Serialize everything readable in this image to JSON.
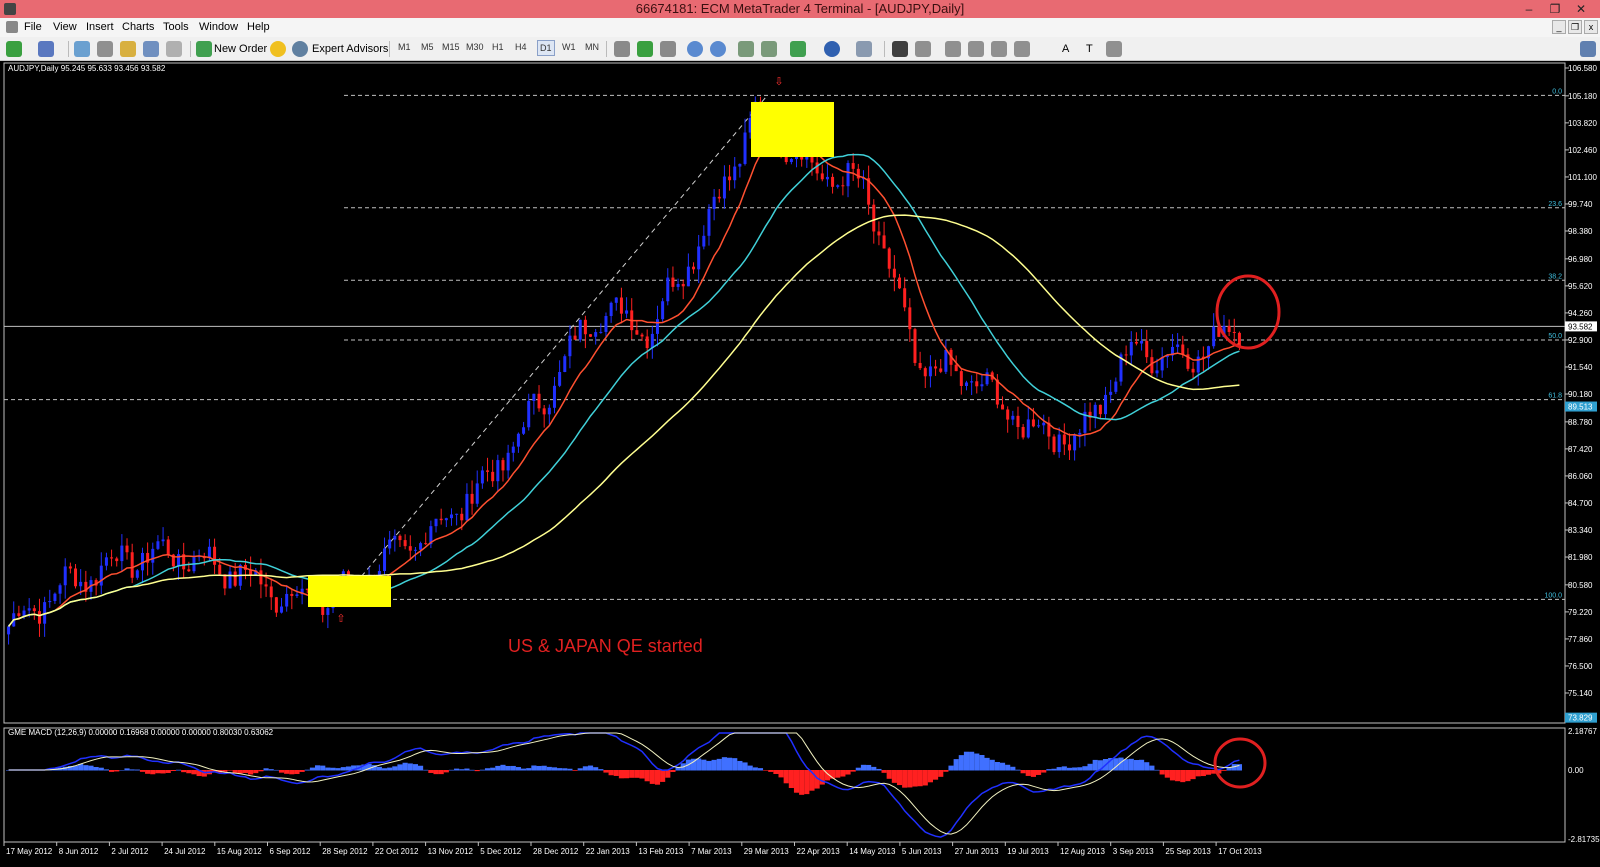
{
  "window": {
    "title": "66674181: ECM MetaTrader 4 Terminal - [AUDJPY,Daily]",
    "controls": [
      "–",
      "❐",
      "✕"
    ],
    "mdi_controls": [
      "_",
      "❐",
      "x"
    ]
  },
  "menu": [
    "File",
    "View",
    "Insert",
    "Charts",
    "Tools",
    "Window",
    "Help"
  ],
  "toolbar": {
    "new_order": "New Order",
    "expert_advisors": "Expert Advisors",
    "timeframes": [
      "M1",
      "M5",
      "M15",
      "M30",
      "H1",
      "H4",
      "D1",
      "W1",
      "MN"
    ],
    "text_tool": "A",
    "label_tool": "T"
  },
  "chart": {
    "info": "AUDJPY,Daily  95.245 95.633 93.456 93.582",
    "price_axis": [
      "106.580",
      "105.180",
      "103.820",
      "102.460",
      "101.100",
      "99.740",
      "98.380",
      "96.980",
      "95.620",
      "94.260",
      "92.900",
      "91.540",
      "90.180",
      "88.780",
      "87.420",
      "86.060",
      "84.700",
      "83.340",
      "81.980",
      "80.580",
      "79.220",
      "77.860",
      "76.500",
      "75.140"
    ],
    "current_price": "93.582",
    "fib_low_tag": "89.513",
    "bottom_tag": "73.829",
    "fib_levels": [
      {
        "label": "0.0",
        "price": 105.2
      },
      {
        "label": "23.6",
        "price": 99.55
      },
      {
        "label": "38.2",
        "price": 95.9
      },
      {
        "label": "50.0",
        "price": 92.9
      },
      {
        "label": "61.8",
        "price": 89.9
      },
      {
        "label": "100.0",
        "price": 79.85
      }
    ],
    "annotation": "US & JAPAN QE started",
    "date_axis": [
      "17 May 2012",
      "8 Jun 2012",
      "2 Jul 2012",
      "24 Jul 2012",
      "15 Aug 2012",
      "6 Sep 2012",
      "28 Sep 2012",
      "22 Oct 2012",
      "13 Nov 2012",
      "5 Dec 2012",
      "28 Dec 2012",
      "22 Jan 2013",
      "13 Feb 2013",
      "7 Mar 2013",
      "29 Mar 2013",
      "22 Apr 2013",
      "14 May 2013",
      "5 Jun 2013",
      "27 Jun 2013",
      "19 Jul 2013",
      "12 Aug 2013",
      "3 Sep 2013",
      "25 Sep 2013",
      "17 Oct 2013"
    ],
    "colors": {
      "bull": "#2030ff",
      "bear": "#ff2020",
      "ma_fast": "#ff5030",
      "ma_mid": "#40d0d8",
      "ma_slow": "#ffff90",
      "highlight": "#ffff00",
      "circle": "#e02020",
      "annotation": "#e02020",
      "axis_text": "#ffffff",
      "fib": "#c0c0c0"
    }
  },
  "macd": {
    "info": "GME MACD (12,26,9) 0.00000 0.16968 0.00000 0.00000 0.80030 0.63062",
    "axis": [
      "2.18767",
      "0.00",
      "-2.81735"
    ]
  },
  "chart_data": {
    "type": "line",
    "title": "AUDJPY,Daily",
    "xlabel": "",
    "ylabel": "",
    "ylim": [
      73.8,
      107.3
    ],
    "x": [
      "17 May 2012",
      "8 Jun 2012",
      "2 Jul 2012",
      "24 Jul 2012",
      "15 Aug 2012",
      "6 Sep 2012",
      "28 Sep 2012",
      "22 Oct 2012",
      "13 Nov 2012",
      "5 Dec 2012",
      "28 Dec 2012",
      "22 Jan 2013",
      "13 Feb 2013",
      "7 Mar 2013",
      "29 Mar 2013",
      "22 Apr 2013",
      "14 May 2013",
      "5 Jun 2013",
      "27 Jun 2013",
      "19 Jul 2013",
      "12 Aug 2013",
      "3 Sep 2013",
      "25 Sep 2013",
      "17 Oct 2013"
    ],
    "series": [
      {
        "values": [
          78.5,
          80.5,
          81.8,
          82.2,
          81.5,
          80.2,
          79.8,
          81.6,
          83.5,
          86.0,
          90.0,
          94.5,
          93.5,
          98.5,
          104.5,
          101.5,
          100.5,
          91.5,
          91.0,
          88.5,
          88.0,
          92.5,
          92.0,
          93.6
        ]
      }
    ]
  }
}
